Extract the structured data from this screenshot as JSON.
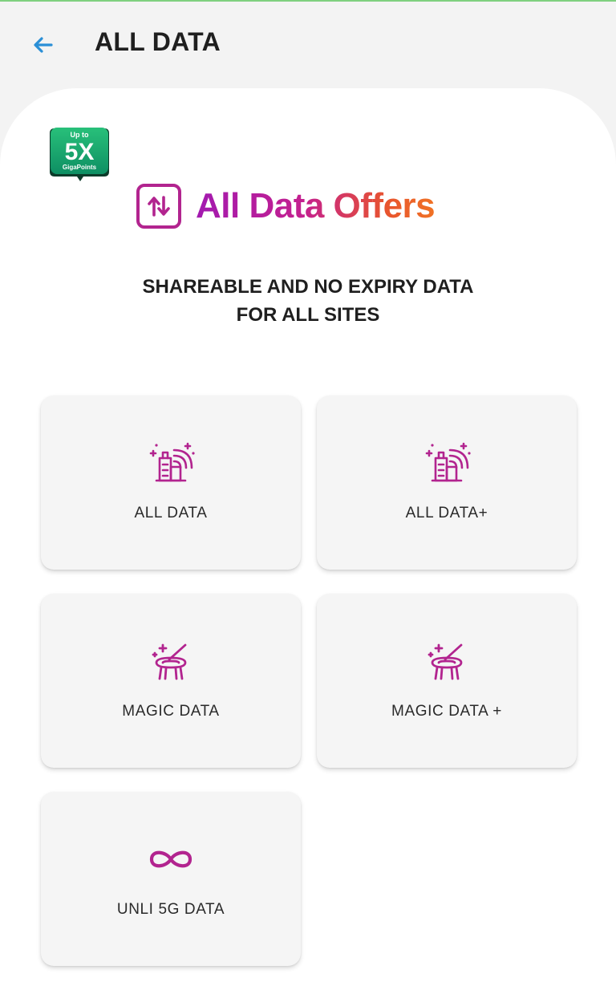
{
  "header": {
    "title": "ALL DATA",
    "back_icon": "arrow-left-icon"
  },
  "badge": {
    "top_text": "Up to",
    "multiplier": "5X",
    "bottom_text": "GigaPoints"
  },
  "brand": {
    "icon": "up-down-arrows-icon",
    "text": "All Data Offers"
  },
  "subtitle": {
    "line1": "SHAREABLE AND NO EXPIRY DATA",
    "line2": "FOR ALL SITES"
  },
  "cards": [
    {
      "label": "ALL DATA",
      "icon": "city-signal-icon"
    },
    {
      "label": "ALL DATA+",
      "icon": "city-signal-icon"
    },
    {
      "label": "MAGIC DATA",
      "icon": "magic-hat-icon"
    },
    {
      "label": "MAGIC DATA +",
      "icon": "magic-hat-icon"
    },
    {
      "label": "UNLI 5G DATA",
      "icon": "infinity-icon"
    }
  ],
  "colors": {
    "accent_icon": "#b2248f",
    "back_arrow": "#2a8fd6",
    "badge_green": "#1fb36a",
    "gradient_start": "#a21ab0",
    "gradient_end": "#f07224"
  }
}
